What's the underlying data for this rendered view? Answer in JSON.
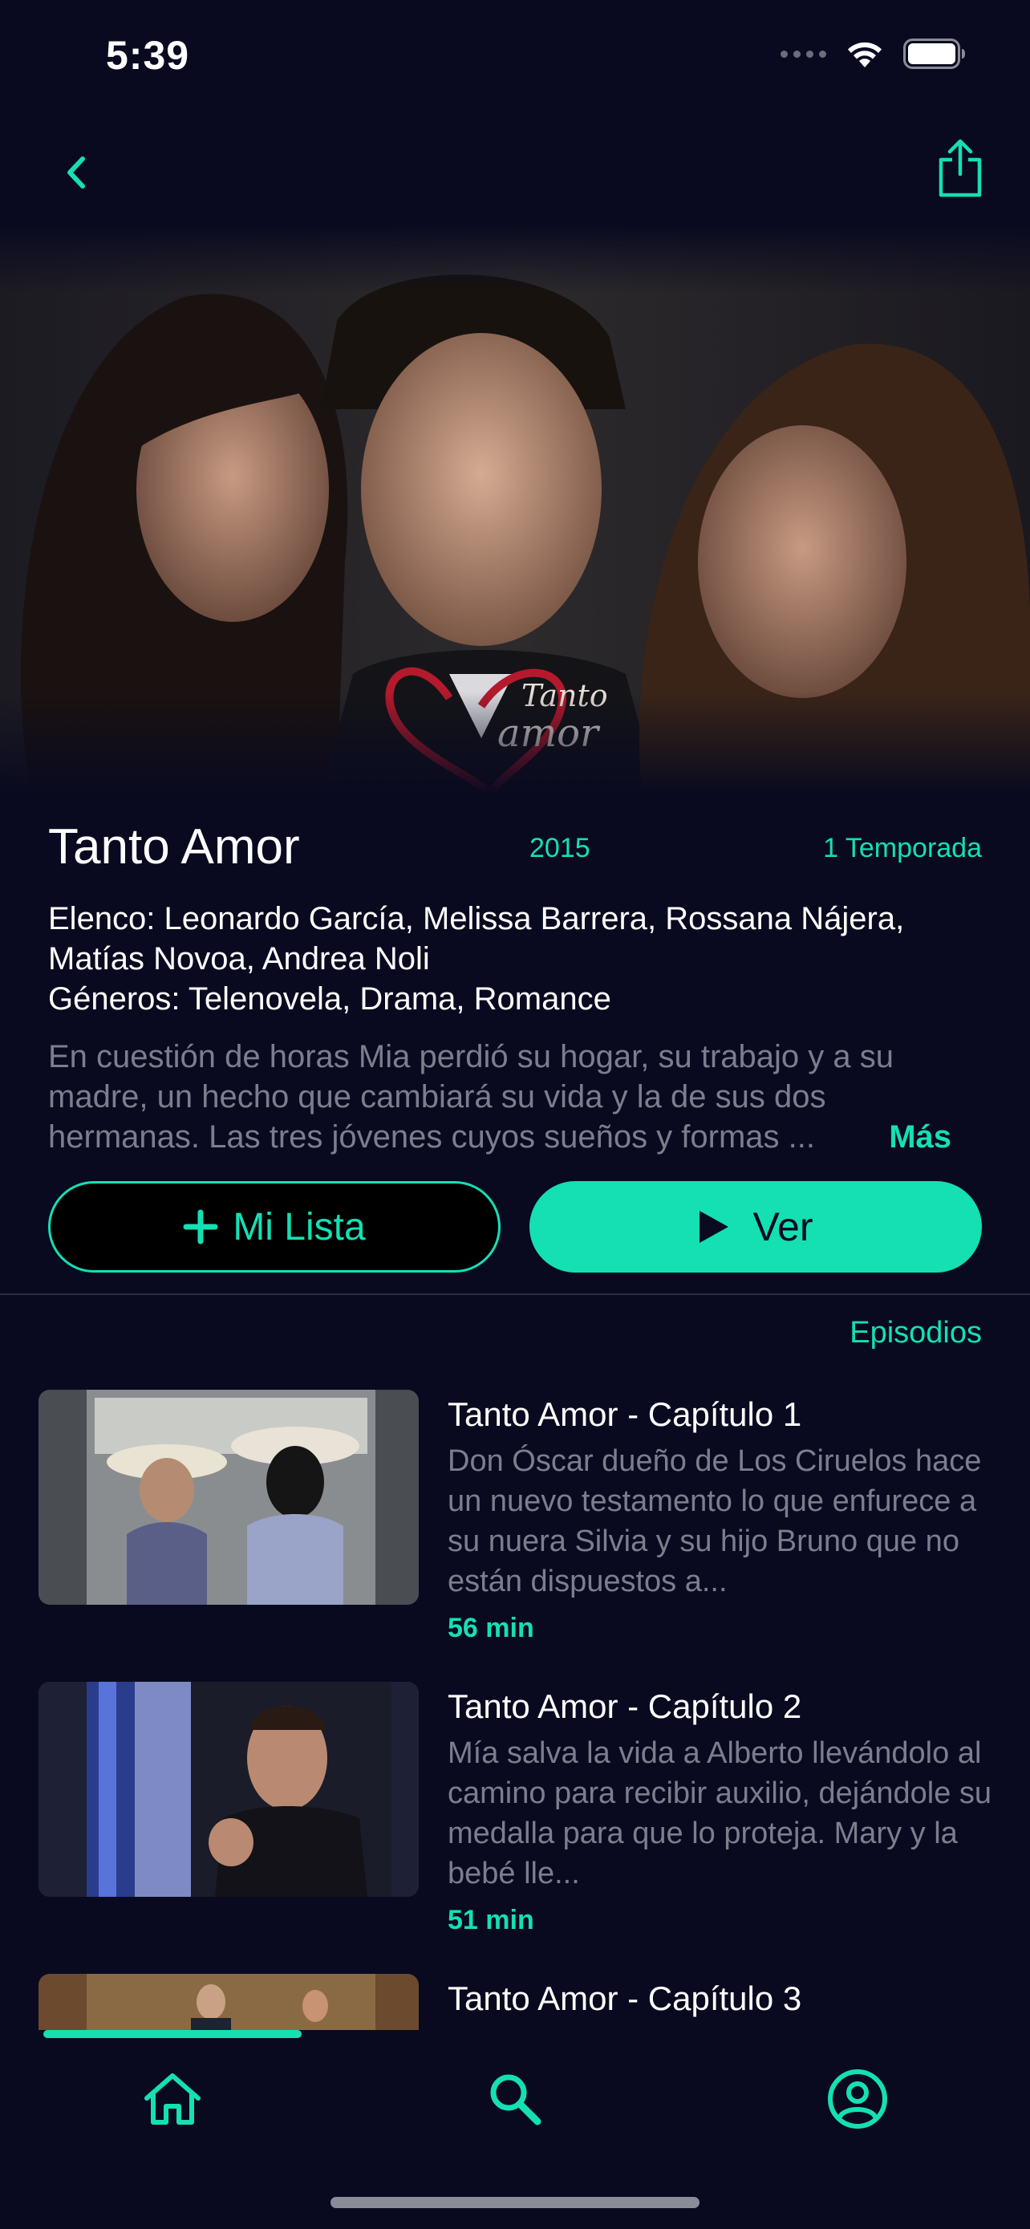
{
  "status_bar": {
    "time": "5:39"
  },
  "colors": {
    "accent": "#14e0b4",
    "background": "#090a20",
    "muted_text": "#7b7e8c"
  },
  "show": {
    "title": "Tanto Amor",
    "year": "2015",
    "seasons": "1 Temporada",
    "cast": "Elenco: Leonardo García, Melissa Barrera, Rossana Nájera, Matías Novoa, Andrea Noli",
    "genres": "Géneros: Telenovela, Drama, Romance",
    "synopsis": "En cuestión de horas Mia perdió su hogar, su trabajo y a su madre, un hecho que cambiará su vida y la de sus dos hermanas. Las tres jóvenes cuyos sueños y formas ...",
    "more_label": "Más",
    "logo_text": "Tanto amor"
  },
  "actions": {
    "list_label": "Mi Lista",
    "watch_label": "Ver"
  },
  "episodes_section": {
    "label": "Episodios",
    "items": [
      {
        "title": "Tanto Amor - Capítulo 1",
        "description": "Don Óscar dueño de Los Ciruelos hace un nuevo testamento lo que enfurece a su nuera Silvia y su hijo Bruno que no están dispuestos a...",
        "duration": "56 min"
      },
      {
        "title": "Tanto Amor - Capítulo 2",
        "description": "Mía salva la vida a Alberto llevándolo al camino para recibir auxilio, dejándole su medalla para que lo proteja. Mary y la bebé lle...",
        "duration": "51 min"
      },
      {
        "title": "Tanto Amor - Capítulo 3",
        "description": "",
        "duration": ""
      }
    ]
  },
  "tabbar": {
    "tabs": [
      {
        "icon": "home-icon",
        "active": true
      },
      {
        "icon": "search-icon",
        "active": false
      },
      {
        "icon": "profile-icon",
        "active": false
      }
    ]
  }
}
